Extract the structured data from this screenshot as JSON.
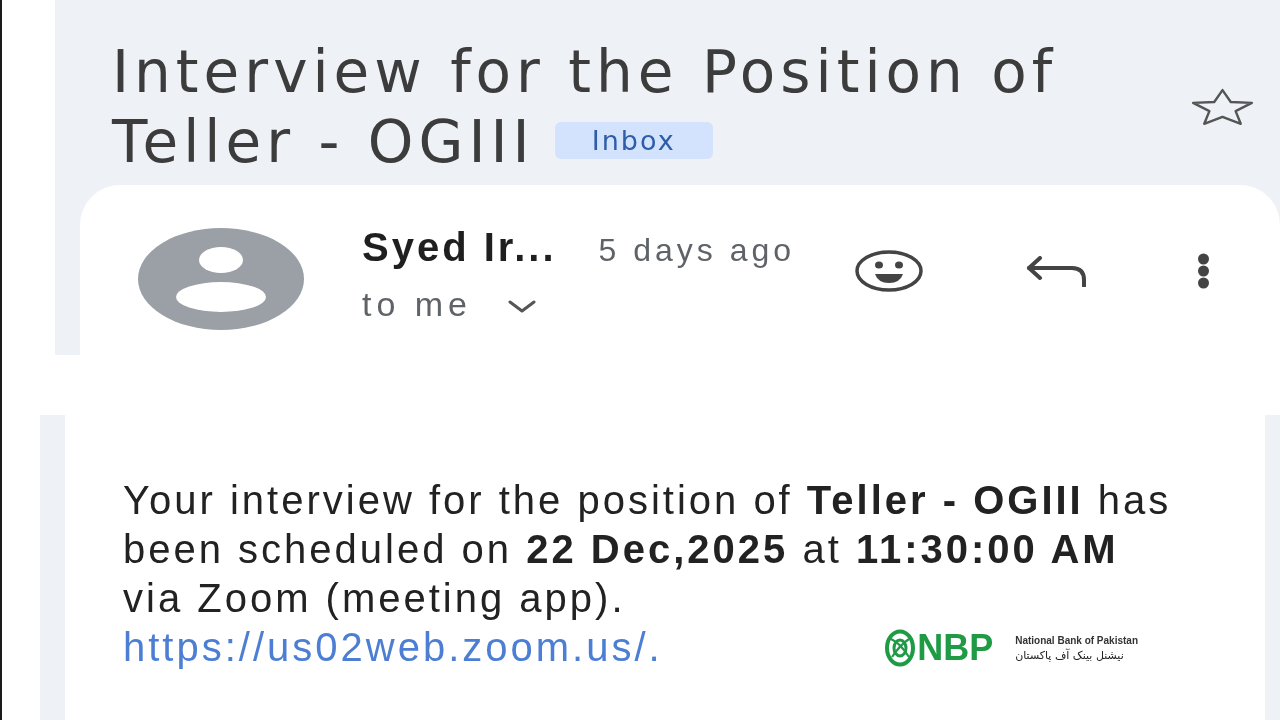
{
  "subject": {
    "title_lines": [
      "Interview for the Position of",
      "Teller - OGIII"
    ],
    "label": "Inbox",
    "starred": false
  },
  "message": {
    "sender": "Syed Ir...",
    "time": "5 days ago",
    "recipient": "to me",
    "details_expanded": false,
    "body": "Your interview for the position of **Teller - OGIII** has been scheduled on **22 Dec,2025** at **11:30:00 AM** via Zoom (meeting app).",
    "link": "https://us02web.zoom.us/."
  },
  "bank_logo": {
    "mark": "NBP",
    "name": "National Bank of Pakistan",
    "name_local": "نیشنل بینک آف پاکستان"
  }
}
